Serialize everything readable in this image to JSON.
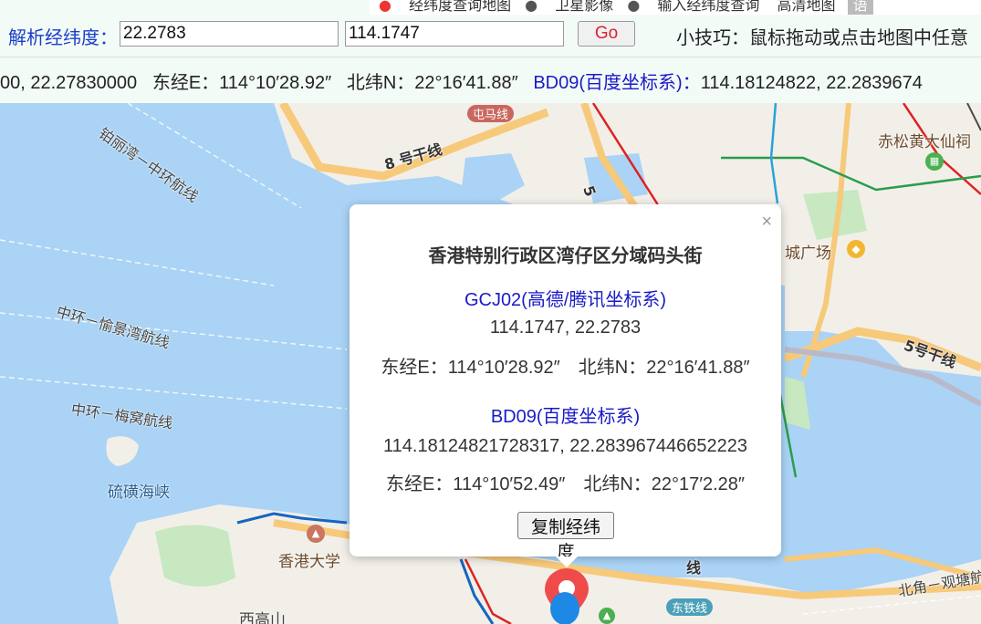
{
  "top_tabs": {
    "tab1": "经纬度查询地图",
    "tab2": "卫星影像",
    "tab3": "输入经纬度查询",
    "tab4": "高清地图",
    "tab5": "语"
  },
  "search": {
    "label": "解析经纬度：",
    "lat_value": "22.2783",
    "lng_value": "114.1747",
    "go_label": "Go",
    "tip": "小技巧：鼠标拖动或点击地图中任意"
  },
  "coord_bar": {
    "prefix": "00, 22.27830000",
    "east": "东经E：114°10′28.92″",
    "north": "北纬N：22°16′41.88″",
    "bd_label": "BD09(百度坐标系)：",
    "bd_value": "114.18124822, 22.2839674"
  },
  "map_labels": {
    "bay_route": "铂丽湾－中环航线",
    "road8": "8 号干线",
    "tuen_ma": "屯马线",
    "wong_tai_sin": "赤松黄大仙祠",
    "plaza": "城广场",
    "road5": "5号干线",
    "road5b": "5",
    "central_yuking": "中环－愉景湾航线",
    "central_mui": "中环－梅窝航线",
    "sulphur": "硫磺海峡",
    "hku": "香港大学",
    "sai_ko": "西高山",
    "east_rail": "东铁线",
    "xian": "线",
    "north_point": "北角－观塘航"
  },
  "popup": {
    "close": "×",
    "title": "香港特别行政区湾仔区分域码头街",
    "gcj_label": "GCJ02(高德/腾讯坐标系)",
    "gcj_value": "114.1747, 22.2783",
    "gcj_dms": "东经E：114°10′28.92″　北纬N：22°16′41.88″",
    "bd_label": "BD09(百度坐标系)",
    "bd_value": "114.18124821728317, 22.283967446652223",
    "bd_dms": "东经E：114°10′52.49″　北纬N：22°17′2.28″",
    "copy_button": "复制经纬度"
  },
  "colors": {
    "water": "#aad3f5",
    "land": "#f2efe9",
    "highway": "#f7c97a",
    "label_blue": "#1a1ac7",
    "go_text": "#dd2233"
  },
  "icons": [
    "close-icon",
    "marker-pin-icon",
    "university-icon",
    "shopping-icon",
    "temple-icon",
    "park-icon"
  ]
}
